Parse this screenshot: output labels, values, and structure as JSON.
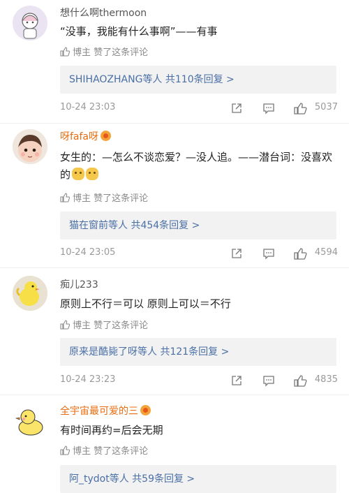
{
  "comments": [
    {
      "username": "想什么啊thermoon",
      "verified": false,
      "text": "“没事，我能有什么事啊”——有事",
      "like_text": "博主 赞了这条评论",
      "replies": "SHIHAOZHANG等人 共110条回复 >",
      "time": "10-24 23:03",
      "likes": "5037"
    },
    {
      "username": "呀fafa呀",
      "verified": true,
      "text": "女生的：—怎么不谈恋爱？—没人追。——潜台词：没喜欢的",
      "like_text": "博主 赞了这条评论",
      "replies": "猫在窗前等人 共454条回复 >",
      "time": "10-24 23:05",
      "likes": "4594"
    },
    {
      "username": "痴儿233",
      "verified": false,
      "text": "原则上不行＝可以 原则上可以＝不行",
      "like_text": "博主 赞了这条评论",
      "replies": "原来是酷毙了呀等人 共121条回复 >",
      "time": "10-24 23:23",
      "likes": "4835"
    },
    {
      "username": "全宇宙最可爱的三",
      "verified": true,
      "text": "有时间再约=后会无期",
      "like_text": "博主 赞了这条评论",
      "replies": "阿_tydot等人 共59条回复 >"
    }
  ],
  "colors": {
    "link": "#4a6fa5",
    "orange_name": "#e86b0f",
    "reply_bg": "#f2f2f2"
  },
  "icons": [
    "thumb-up-icon",
    "share-icon",
    "comment-icon",
    "like-icon",
    "vip-badge-icon"
  ]
}
